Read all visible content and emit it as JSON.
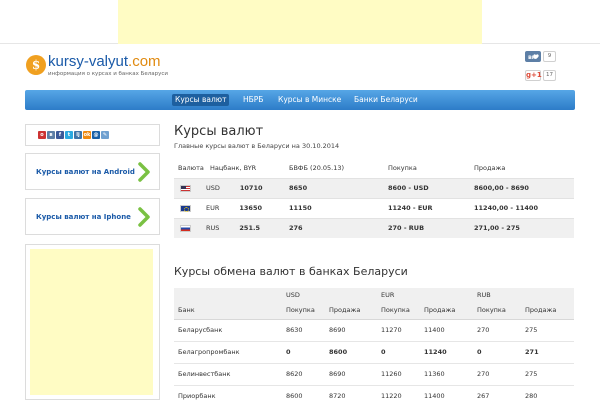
{
  "header": {
    "logo_letter": "$",
    "logo_name": "kursy-valyut",
    "logo_suffix": ".com",
    "logo_tagline": "информация о курсах и банках Беларуси",
    "vk_count": "9",
    "gplus_label": "g+1",
    "gplus_count": "17"
  },
  "nav": {
    "items": [
      {
        "label": "Курсы валют",
        "active": true
      },
      {
        "label": "НБРБ",
        "active": false
      },
      {
        "label": "Курсы в Минске",
        "active": false
      },
      {
        "label": "Банки Беларуси",
        "active": false
      }
    ]
  },
  "sidebar": {
    "share_icons": [
      {
        "name": "opera-icon",
        "glyph": "о",
        "color": "#cc3333"
      },
      {
        "name": "bookmark-icon",
        "glyph": "в",
        "color": "#5d7fa6"
      },
      {
        "name": "facebook-icon",
        "glyph": "f",
        "color": "#3b5998"
      },
      {
        "name": "twitter-icon",
        "glyph": "t",
        "color": "#2aa9e0"
      },
      {
        "name": "livejournal-icon",
        "glyph": "lj",
        "color": "#3d74a8"
      },
      {
        "name": "odnoklassniki-icon",
        "glyph": "ok",
        "color": "#f08a10"
      },
      {
        "name": "mailru-icon",
        "glyph": "@",
        "color": "#1860a8"
      },
      {
        "name": "link-icon",
        "glyph": "✎",
        "color": "#6fa0d0"
      }
    ],
    "android_label": "Курсы валют на Android",
    "iphone_label": "Курсы валют на Iphone",
    "arrow_color": "#7ac143"
  },
  "main": {
    "title": "Курсы валют",
    "subtitle": "Главные курсы валют в Беларуси на 30.10.2014",
    "rates_table": {
      "headers": [
        "Валюта",
        "Нацбанк, BYR",
        "БВФБ (20.05.13)",
        "Покупка",
        "Продажа"
      ],
      "rows": [
        {
          "flag": "us",
          "code": "USD",
          "nbrb": "10710",
          "bvfb": "8650",
          "buy": "8600 - USD",
          "sell": "8600,00 - 8690"
        },
        {
          "flag": "eu",
          "code": "EUR",
          "nbrb": "13650",
          "bvfb": "11150",
          "buy": "11240 - EUR",
          "sell": "11240,00 - 11400"
        },
        {
          "flag": "ru",
          "code": "RUS",
          "nbrb": "251.5",
          "bvfb": "276",
          "buy": "270 - RUB",
          "sell": "271,00 - 275"
        }
      ]
    },
    "banks_title": "Курсы обмена валют в банках Беларуси",
    "banks_table": {
      "groups": [
        "USD",
        "EUR",
        "RUB"
      ],
      "bank_col": "Банк",
      "buy": "Покупка",
      "sell": "Продажа",
      "rows": [
        {
          "bank": "Беларусбанк",
          "vals": [
            "8630",
            "8690",
            "11270",
            "11400",
            "270",
            "275"
          ],
          "bold": [
            false,
            false,
            false,
            false,
            false,
            false
          ]
        },
        {
          "bank": "Белагропромбанк",
          "vals": [
            "0",
            "8600",
            "0",
            "11240",
            "0",
            "271"
          ],
          "bold": [
            true,
            true,
            true,
            true,
            true,
            true
          ]
        },
        {
          "bank": "Белинвестбанк",
          "vals": [
            "8620",
            "8690",
            "11260",
            "11360",
            "270",
            "275"
          ],
          "bold": [
            false,
            false,
            false,
            false,
            false,
            false
          ]
        },
        {
          "bank": "Приорбанк",
          "vals": [
            "8600",
            "8720",
            "11220",
            "11400",
            "267",
            "280"
          ],
          "bold": [
            false,
            false,
            false,
            false,
            false,
            false
          ]
        }
      ]
    }
  }
}
